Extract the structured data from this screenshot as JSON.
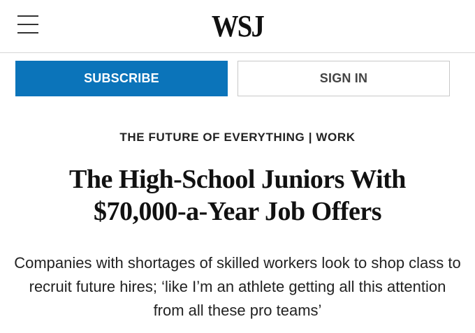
{
  "header": {
    "logo_text": "WSJ",
    "menu_icon": "hamburger-menu-icon"
  },
  "actions": {
    "subscribe_label": "SUBSCRIBE",
    "signin_label": "SIGN IN",
    "subscribe_color": "#0b74ba"
  },
  "article": {
    "kicker": "THE FUTURE OF EVERYTHING | WORK",
    "headline": "The High-School Juniors With $70,000-a-Year Job Offers",
    "dek": "Companies with shortages of skilled workers look to shop class to recruit future hires; ‘like I’m an athlete getting all this attention from all these pro teams’"
  }
}
